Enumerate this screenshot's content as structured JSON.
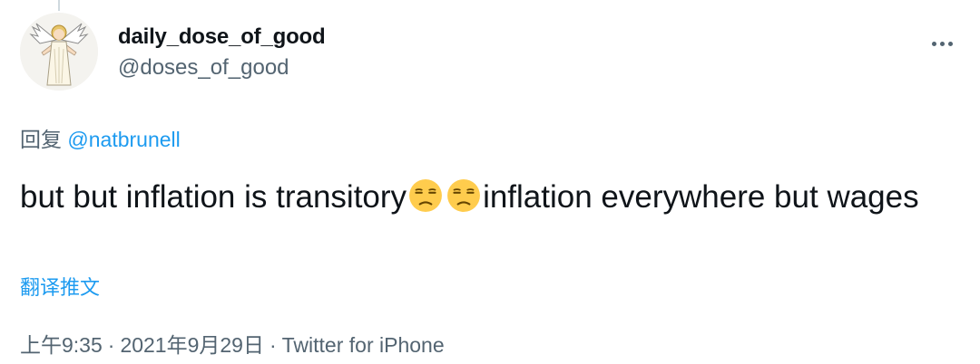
{
  "author": {
    "display_name": "daily_dose_of_good",
    "handle": "@doses_of_good",
    "avatar_icon": "angel-avatar-icon"
  },
  "reply": {
    "prefix": "回复",
    "mention": "@natbrunell"
  },
  "tweet": {
    "text_before_emoji": "but but inflation is transitory",
    "emoji_name": "unamused-face-emoji",
    "text_after_emoji": "inflation everywhere but wages"
  },
  "translate_label": "翻译推文",
  "meta": {
    "time": "上午9:35",
    "date": "2021年9月29日",
    "separator": "·",
    "source": "Twitter for iPhone"
  },
  "colors": {
    "text": "#0f1419",
    "muted": "#536471",
    "link": "#1d9bf0",
    "emoji": "#ffcc4d"
  }
}
